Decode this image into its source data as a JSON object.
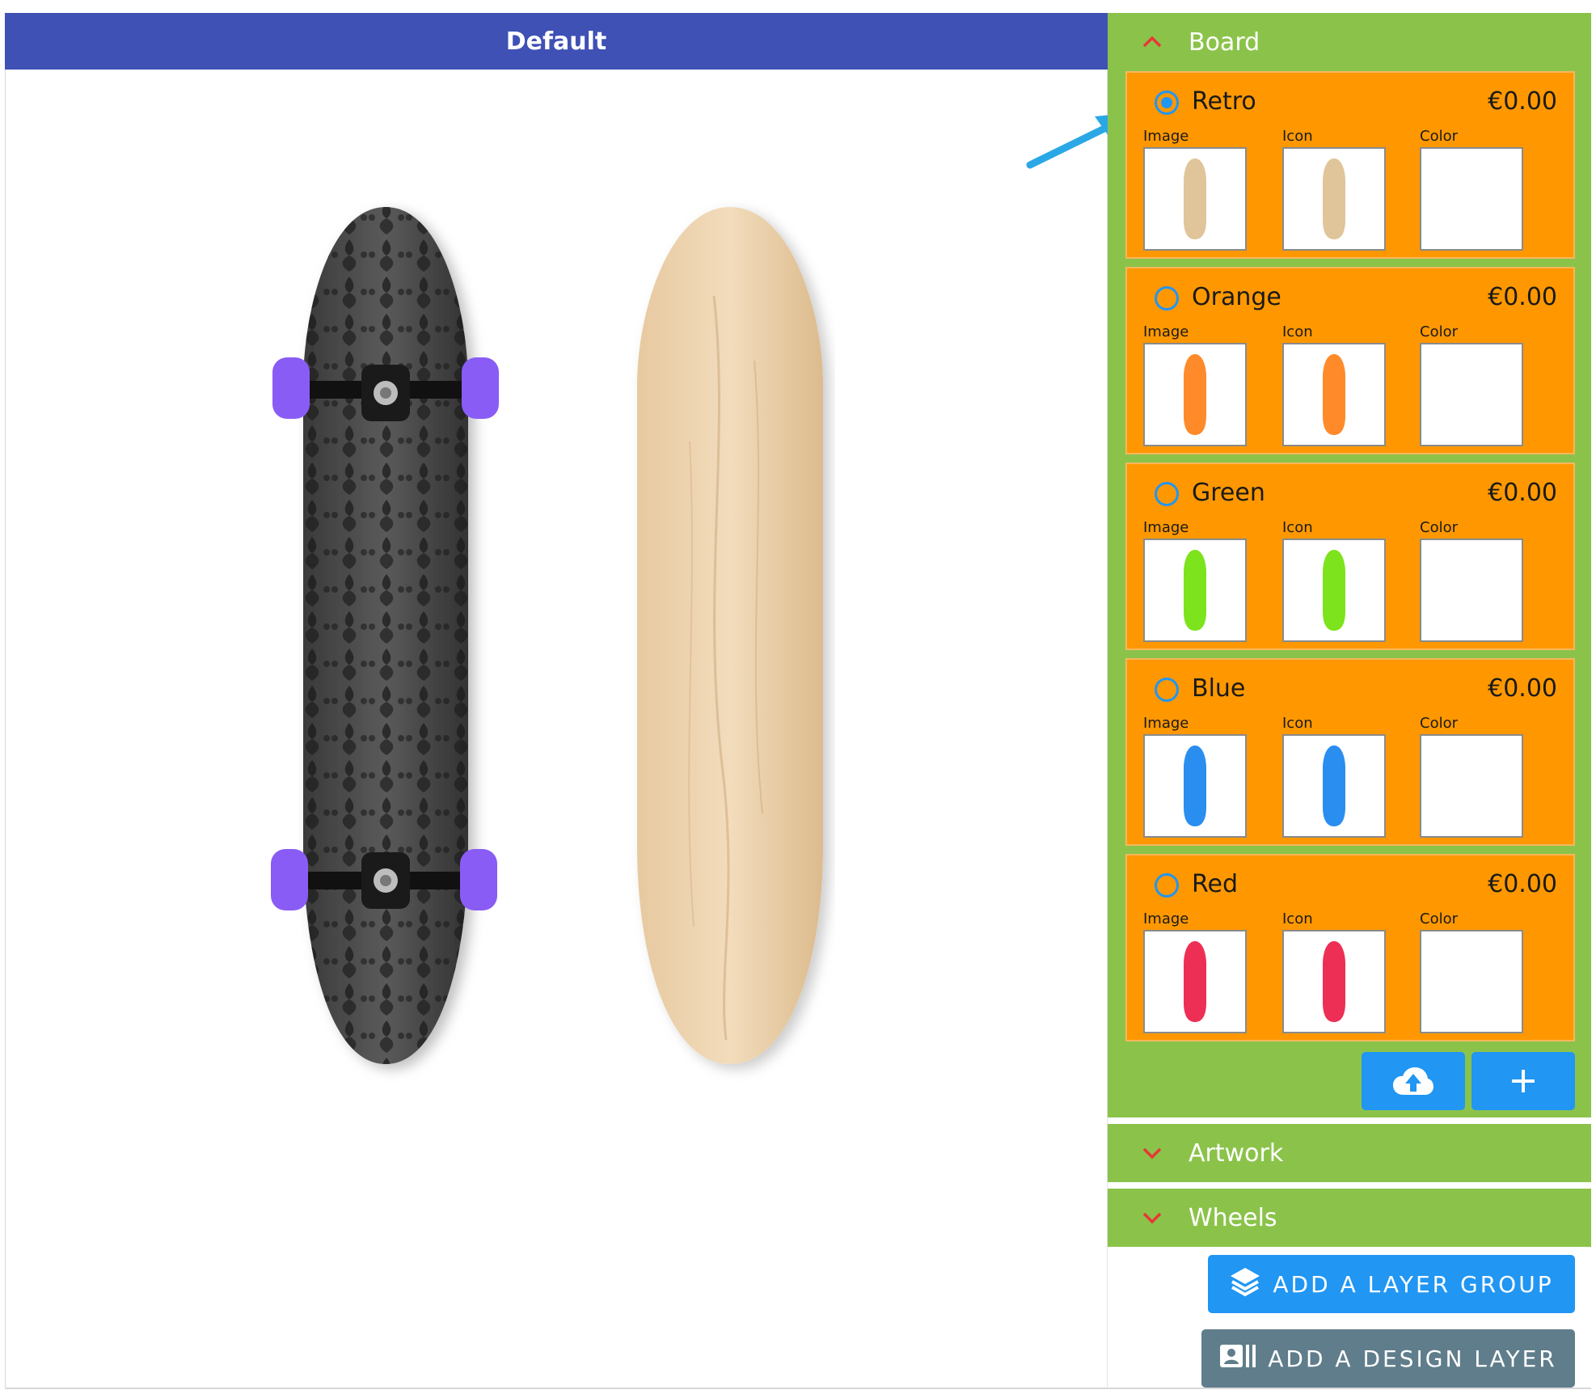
{
  "preview": {
    "title": "Default"
  },
  "sidebar": {
    "board": {
      "title": "Board",
      "options": [
        {
          "name": "Retro",
          "price": "€0.00",
          "selected": true,
          "tint": "#e0c49a"
        },
        {
          "name": "Orange",
          "price": "€0.00",
          "selected": false,
          "tint": "#ff8a2a"
        },
        {
          "name": "Green",
          "price": "€0.00",
          "selected": false,
          "tint": "#7de31c"
        },
        {
          "name": "Blue",
          "price": "€0.00",
          "selected": false,
          "tint": "#2a8ef0"
        },
        {
          "name": "Red",
          "price": "€0.00",
          "selected": false,
          "tint": "#ee2f55"
        }
      ],
      "labels": {
        "image": "Image",
        "icon": "Icon",
        "color": "Color"
      },
      "upload_icon": "cloud-upload-icon",
      "add_icon": "plus-icon"
    },
    "artwork": {
      "title": "Artwork"
    },
    "wheels": {
      "title": "Wheels"
    },
    "add_layer_group": "ADD A LAYER GROUP",
    "add_design_layer": "ADD A DESIGN LAYER"
  },
  "colors": {
    "header": "#3f51b5",
    "section": "#8bc34a",
    "option": "#ff9800",
    "accent_blue": "#2196f3",
    "chevron": "#e53935",
    "gray_button": "#607d8b"
  }
}
